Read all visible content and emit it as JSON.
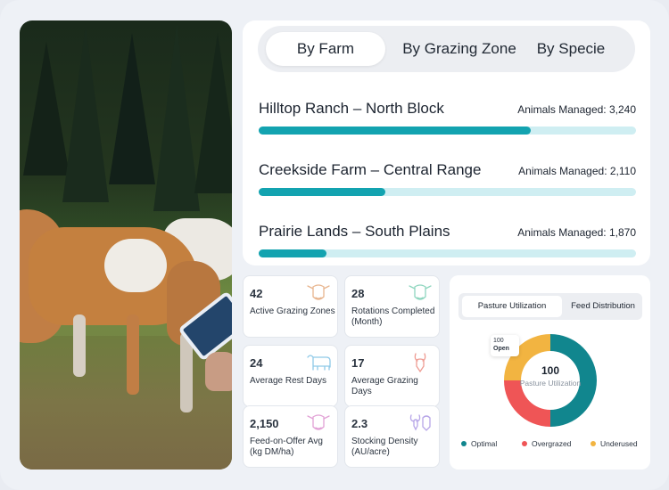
{
  "tabs": [
    {
      "label": "By Farm",
      "active": true
    },
    {
      "label": "By Grazing Zone",
      "active": false
    },
    {
      "label": "By Specie",
      "active": false
    }
  ],
  "farms": [
    {
      "name": "Hilltop Ranch – North Block",
      "count_text": "Animals Managed: 3,240",
      "progress": 0.72
    },
    {
      "name": "Creekside Farm – Central Range",
      "count_text": "Animals Managed: 2,110",
      "progress": 0.335
    },
    {
      "name": "Prairie Lands – South Plains",
      "count_text": "Animals Managed: 1,870",
      "progress": 0.18
    }
  ],
  "stats": [
    {
      "value": "42",
      "label": "Active Grazing Zones",
      "icon": "cow-icon",
      "color": "#e8b58f"
    },
    {
      "value": "28",
      "label": "Rotations Completed (Month)",
      "icon": "cow-icon",
      "color": "#8fd6bf"
    },
    {
      "value": "24",
      "label": "Average Rest Days",
      "icon": "cow-icon",
      "color": "#8fc9e8"
    },
    {
      "value": "17",
      "label": "Average Grazing Days",
      "icon": "goat-icon",
      "color": "#ee9c93"
    },
    {
      "value": "2,150",
      "label": "Feed-on-Offer Avg (kg DM/ha)",
      "icon": "cow-icon",
      "color": "#e2a2d6"
    },
    {
      "value": "2.3",
      "label": "Stocking Density (AU/acre)",
      "icon": "goat-icon",
      "color": "#b7a6e8"
    }
  ],
  "donut_tabs": [
    {
      "label": "Pasture Utilization",
      "active": true
    },
    {
      "label": "Feed Distribution",
      "active": false
    }
  ],
  "donut": {
    "center_value": "100",
    "center_label": "Pasture Utilization",
    "tooltip_value": "100",
    "tooltip_label": "Open",
    "segments": [
      {
        "name": "Optimal",
        "value": 50,
        "color": "#11868e"
      },
      {
        "name": "Overgrazed",
        "value": 25,
        "color": "#ef5556"
      },
      {
        "name": "Underused",
        "value": 25,
        "color": "#f2b441"
      }
    ]
  },
  "legend": {
    "optimal": "Optimal",
    "overgrazed": "Overgrazed",
    "underused": "Underused"
  }
}
